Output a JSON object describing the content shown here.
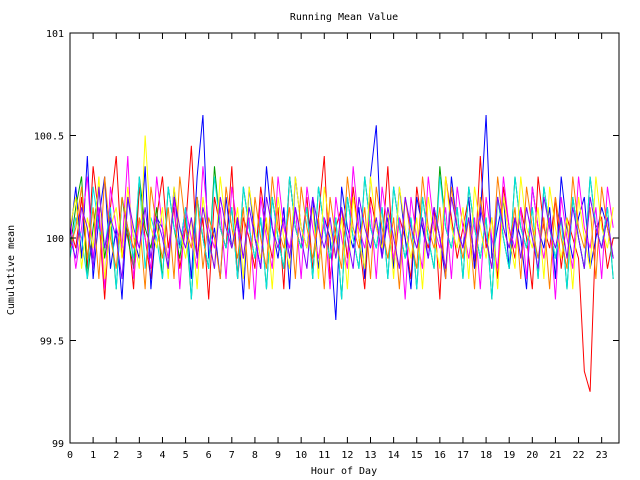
{
  "chart_data": {
    "type": "line",
    "title": "Running Mean Value",
    "xlabel": "Hour of Day",
    "ylabel": "Cumulative mean",
    "xlim": [
      0,
      23.75
    ],
    "ylim": [
      99,
      101
    ],
    "x_ticks": [
      0,
      1,
      2,
      3,
      4,
      5,
      6,
      7,
      8,
      9,
      10,
      11,
      12,
      13,
      14,
      15,
      16,
      17,
      18,
      19,
      20,
      21,
      22,
      23
    ],
    "x_tick_labels": [
      "0",
      "1",
      "2",
      "3",
      "4",
      "5",
      "6",
      "7",
      "8",
      "9",
      "10",
      "11",
      "12",
      "13",
      "14",
      "15",
      "16",
      "17",
      "18",
      "19",
      "20",
      "21",
      "22",
      "23"
    ],
    "y_ticks": [
      99,
      99.5,
      100,
      100.5,
      101
    ],
    "y_tick_labels": [
      "99",
      "99.5",
      "100",
      "100.5",
      "101"
    ],
    "grid": false,
    "legend": "none",
    "sample_interval_hours": 0.25,
    "series": [
      {
        "color": "#ff0000",
        "values": [
          100.05,
          99.95,
          100.2,
          99.85,
          100.35,
          100.1,
          99.7,
          100.15,
          100.4,
          99.9,
          100.05,
          99.75,
          100.25,
          100.0,
          99.8,
          100.1,
          100.3,
          99.95,
          100.15,
          99.85,
          100.05,
          100.45,
          99.9,
          100.1,
          99.7,
          100.2,
          100.05,
          99.95,
          100.35,
          99.8,
          100.1,
          100.0,
          99.85,
          100.25,
          100.05,
          99.9,
          100.15,
          99.75,
          100.3,
          100.05,
          99.95,
          100.2,
          99.85,
          100.1,
          100.4,
          99.8,
          100.05,
          100.15,
          99.9,
          100.25,
          100.0,
          99.75,
          100.2,
          100.05,
          99.95,
          100.35,
          99.85,
          100.1,
          100.0,
          99.8,
          100.25,
          100.05,
          99.95,
          100.15,
          99.7,
          100.3,
          100.1,
          99.9,
          100.05,
          100.2,
          99.85,
          100.4,
          99.95,
          100.1,
          99.8,
          100.25,
          100.05,
          99.9,
          100.15,
          100.0,
          99.75,
          100.3,
          100.05,
          99.95,
          100.2,
          99.85,
          100.1,
          100.0,
          99.9,
          99.35,
          99.25,
          100.05,
          100.1,
          99.85,
          100.0
        ]
      },
      {
        "color": "#0000ff",
        "values": [
          100.0,
          100.25,
          99.9,
          100.4,
          99.8,
          100.1,
          100.3,
          99.85,
          100.05,
          99.7,
          100.2,
          100.0,
          99.9,
          100.35,
          99.75,
          100.1,
          100.05,
          99.85,
          100.25,
          99.95,
          100.15,
          99.8,
          100.3,
          100.6,
          99.9,
          100.05,
          99.8,
          100.2,
          99.95,
          100.1,
          99.7,
          100.25,
          100.0,
          99.85,
          100.35,
          100.05,
          99.9,
          100.15,
          99.75,
          100.3,
          100.05,
          99.95,
          100.2,
          99.85,
          100.1,
          100.0,
          99.6,
          100.25,
          100.05,
          99.95,
          100.15,
          99.8,
          100.3,
          100.55,
          99.9,
          100.1,
          99.85,
          100.25,
          100.0,
          99.75,
          100.2,
          100.05,
          99.9,
          100.15,
          100.0,
          99.8,
          100.3,
          100.05,
          99.95,
          100.2,
          99.85,
          100.1,
          100.6,
          99.9,
          100.05,
          100.2,
          99.85,
          100.1,
          100.0,
          99.75,
          100.25,
          100.05,
          99.95,
          100.15,
          99.8,
          100.3,
          100.05,
          99.9,
          100.1,
          100.2,
          99.85,
          100.0,
          100.15,
          100.05,
          99.9
        ]
      },
      {
        "color": "#00a000",
        "values": [
          99.95,
          100.15,
          100.3,
          99.8,
          100.05,
          100.25,
          99.9,
          100.1,
          99.75,
          100.2,
          100.0,
          99.85,
          100.3,
          100.05,
          99.95,
          100.15,
          99.8,
          100.25,
          100.05,
          99.9,
          100.1,
          99.7,
          100.2,
          100.0,
          99.85,
          100.35,
          100.05,
          99.95,
          100.15,
          99.8,
          100.25,
          100.05,
          99.9,
          100.1,
          99.75,
          100.2,
          100.0,
          99.85,
          100.3,
          100.05,
          99.95,
          100.15,
          99.8,
          100.25,
          100.05,
          99.9,
          100.1,
          99.7,
          100.2,
          100.0,
          99.85,
          100.3,
          100.05,
          99.95,
          100.15,
          99.8,
          100.25,
          100.05,
          99.9,
          100.1,
          99.75,
          100.2,
          100.0,
          99.85,
          100.35,
          100.05,
          99.95,
          100.15,
          99.8,
          100.25,
          100.05,
          99.9,
          100.1,
          99.7,
          100.2,
          100.0,
          99.85,
          100.3,
          100.05,
          99.95,
          100.15,
          99.8,
          100.25,
          100.05,
          99.9,
          100.1,
          99.75,
          100.2,
          100.0,
          99.85,
          100.3,
          100.05,
          99.95,
          100.15,
          99.8
        ]
      },
      {
        "color": "#ff00ff",
        "values": [
          100.1,
          99.85,
          100.05,
          100.3,
          99.9,
          100.15,
          99.75,
          100.25,
          100.05,
          99.95,
          100.4,
          99.8,
          100.1,
          100.0,
          99.85,
          100.3,
          100.05,
          99.9,
          100.2,
          99.75,
          100.15,
          100.0,
          99.85,
          100.35,
          100.05,
          99.95,
          100.15,
          99.8,
          100.25,
          100.05,
          99.9,
          100.1,
          99.7,
          100.2,
          100.0,
          99.85,
          100.3,
          100.05,
          99.95,
          100.15,
          99.8,
          100.25,
          100.05,
          99.9,
          100.1,
          99.75,
          100.2,
          100.0,
          99.85,
          100.35,
          100.05,
          99.95,
          100.15,
          99.8,
          100.25,
          100.05,
          99.9,
          100.1,
          99.7,
          100.2,
          100.0,
          99.85,
          100.3,
          100.05,
          99.95,
          100.15,
          99.8,
          100.25,
          100.05,
          99.9,
          100.1,
          99.75,
          100.2,
          100.0,
          99.85,
          100.3,
          100.05,
          99.95,
          100.15,
          99.8,
          100.25,
          100.05,
          99.9,
          100.1,
          99.7,
          100.2,
          100.0,
          99.85,
          100.3,
          100.05,
          99.95,
          100.15,
          99.8,
          100.25,
          100.05
        ]
      },
      {
        "color": "#00e0e0",
        "values": [
          99.9,
          100.1,
          100.0,
          99.8,
          100.25,
          100.05,
          99.95,
          100.15,
          99.75,
          100.2,
          100.05,
          99.9,
          100.3,
          99.85,
          100.1,
          100.0,
          99.8,
          100.25,
          100.05,
          99.95,
          100.15,
          99.7,
          100.2,
          100.0,
          99.85,
          100.3,
          100.05,
          99.95,
          100.15,
          99.8,
          100.25,
          100.05,
          99.9,
          100.1,
          99.75,
          100.2,
          100.0,
          99.85,
          100.3,
          100.05,
          99.95,
          100.15,
          99.8,
          100.25,
          100.05,
          99.9,
          100.1,
          99.7,
          100.2,
          100.0,
          99.85,
          100.3,
          100.05,
          99.95,
          100.15,
          99.8,
          100.25,
          100.05,
          99.9,
          100.1,
          99.75,
          100.2,
          100.0,
          99.85,
          100.3,
          100.05,
          99.95,
          100.15,
          99.8,
          100.25,
          100.05,
          99.9,
          100.1,
          99.7,
          100.2,
          100.0,
          99.85,
          100.3,
          100.05,
          99.95,
          100.15,
          99.8,
          100.25,
          100.05,
          99.9,
          100.1,
          99.75,
          100.2,
          100.0,
          99.85,
          100.3,
          100.05,
          99.95,
          100.15,
          99.8
        ]
      },
      {
        "color": "#ffff00",
        "values": [
          100.05,
          100.2,
          99.85,
          100.1,
          99.95,
          100.3,
          99.8,
          100.05,
          100.15,
          99.9,
          100.25,
          100.0,
          99.85,
          100.5,
          100.05,
          99.95,
          100.15,
          99.8,
          100.25,
          100.05,
          99.9,
          100.1,
          99.75,
          100.2,
          100.0,
          99.85,
          100.3,
          100.05,
          99.95,
          100.15,
          99.8,
          100.25,
          100.05,
          99.9,
          100.1,
          99.75,
          100.2,
          100.0,
          99.85,
          100.3,
          100.05,
          99.95,
          100.15,
          99.8,
          100.25,
          100.05,
          99.9,
          100.1,
          99.75,
          100.2,
          100.0,
          99.85,
          100.3,
          100.05,
          99.95,
          100.15,
          99.8,
          100.25,
          100.05,
          99.9,
          100.1,
          99.75,
          100.2,
          100.0,
          99.85,
          100.3,
          100.05,
          99.95,
          100.15,
          99.8,
          100.25,
          100.05,
          99.9,
          100.1,
          99.75,
          100.2,
          100.0,
          99.85,
          100.3,
          100.05,
          99.95,
          100.15,
          99.8,
          100.25,
          100.05,
          99.9,
          100.1,
          99.75,
          100.2,
          100.0,
          99.85,
          100.3,
          100.05,
          99.95,
          100.15
        ]
      },
      {
        "color": "#ff8000",
        "values": [
          99.95,
          100.05,
          100.25,
          99.9,
          100.15,
          99.8,
          100.3,
          100.0,
          99.85,
          100.2,
          100.05,
          99.95,
          100.1,
          99.75,
          100.25,
          100.05,
          99.9,
          100.15,
          99.8,
          100.3,
          100.05,
          99.95,
          100.2,
          99.85,
          100.1,
          100.0,
          99.8,
          100.25,
          100.05,
          99.9,
          100.15,
          99.75,
          100.2,
          100.0,
          99.85,
          100.3,
          100.05,
          99.95,
          100.15,
          99.8,
          100.25,
          100.05,
          99.9,
          100.1,
          99.75,
          100.2,
          100.0,
          99.85,
          100.3,
          100.05,
          99.95,
          100.15,
          99.8,
          100.25,
          100.05,
          99.9,
          100.1,
          99.75,
          100.2,
          100.0,
          99.85,
          100.3,
          100.05,
          99.95,
          100.15,
          99.8,
          100.25,
          100.05,
          99.9,
          100.1,
          99.75,
          100.2,
          100.0,
          99.85,
          100.3,
          100.05,
          99.95,
          100.15,
          99.8,
          100.25,
          100.05,
          99.9,
          100.1,
          99.75,
          100.2,
          100.0,
          99.85,
          100.3,
          100.05,
          99.95,
          100.15,
          99.8,
          100.25,
          100.05,
          99.9
        ]
      },
      {
        "color": "#8000ff",
        "values": [
          100.0,
          99.9,
          100.15,
          100.05,
          99.85,
          100.25,
          99.95,
          100.1,
          100.0,
          99.8,
          100.2,
          100.05,
          99.95,
          100.15,
          99.9,
          100.1,
          100.0,
          99.85,
          100.2,
          100.05,
          99.95,
          100.1,
          99.9,
          100.15,
          100.0,
          99.85,
          100.2,
          100.05,
          99.95,
          100.1,
          99.9,
          100.15,
          100.0,
          99.85,
          100.2,
          100.05,
          99.95,
          100.1,
          99.9,
          100.15,
          100.0,
          99.85,
          100.2,
          100.05,
          99.95,
          100.1,
          99.9,
          100.15,
          100.0,
          99.85,
          100.2,
          100.05,
          99.95,
          100.1,
          99.9,
          100.15,
          100.0,
          99.85,
          100.2,
          100.05,
          99.95,
          100.1,
          99.9,
          100.15,
          100.0,
          99.85,
          100.2,
          100.05,
          99.95,
          100.1,
          99.9,
          100.15,
          100.0,
          99.85,
          100.2,
          100.05,
          99.95,
          100.1,
          99.9,
          100.15,
          100.0,
          99.85,
          100.2,
          100.05,
          99.95,
          100.1,
          99.9,
          100.15,
          100.0,
          99.85,
          100.2,
          100.05,
          99.95,
          100.1,
          99.9
        ]
      }
    ]
  }
}
